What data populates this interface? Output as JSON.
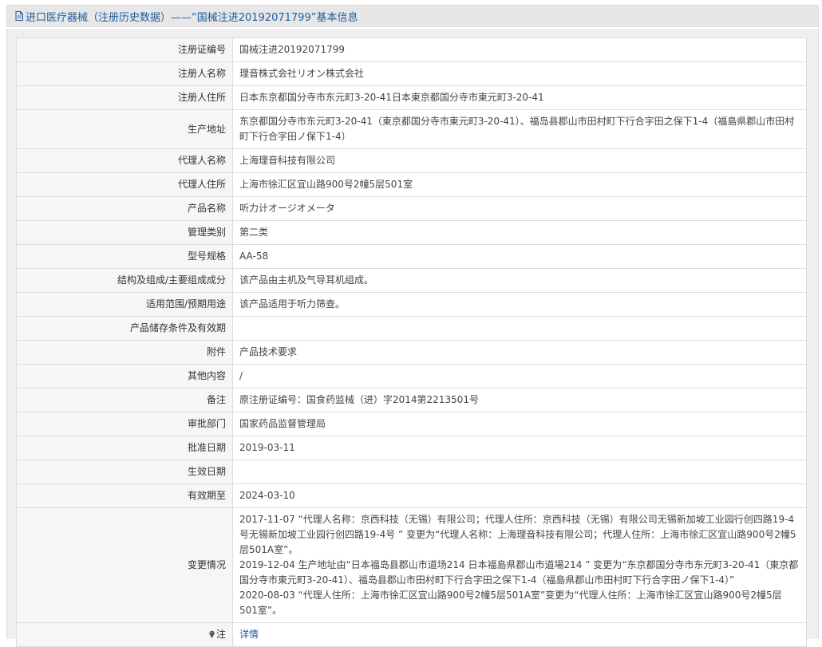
{
  "header": {
    "title": "进口医疗器械（注册历史数据）——“国械注进20192071799”基本信息"
  },
  "rows": [
    {
      "label": "注册证编号",
      "value": "国械注进20192071799"
    },
    {
      "label": "注册人名称",
      "value": "理音株式会社リオン株式会社"
    },
    {
      "label": "注册人住所",
      "value": "日本东京都国分寺市东元町3-20-41日本東京都国分寺市東元町3-20-41"
    },
    {
      "label": "生产地址",
      "value": "东京都国分寺市东元町3-20-41（東京都国分寺市東元町3-20-41）、福岛县郡山市田村町下行合字田之保下1-4（福島県郡山市田村町下行合字田ノ保下1-4）"
    },
    {
      "label": "代理人名称",
      "value": "上海理音科技有限公司"
    },
    {
      "label": "代理人住所",
      "value": "上海市徐汇区宜山路900号2幢5层501室"
    },
    {
      "label": "产品名称",
      "value": "听力计オージオメータ"
    },
    {
      "label": "管理类别",
      "value": "第二类"
    },
    {
      "label": "型号规格",
      "value": "AA-58"
    },
    {
      "label": "结构及组成/主要组成成分",
      "value": "该产品由主机及气导耳机组成。"
    },
    {
      "label": "适用范围/预期用途",
      "value": "该产品适用于听力筛查。"
    },
    {
      "label": "产品储存条件及有效期",
      "value": ""
    },
    {
      "label": "附件",
      "value": "产品技术要求"
    },
    {
      "label": "其他内容",
      "value": "/"
    },
    {
      "label": "备注",
      "value": "原注册证编号：国食药监械（进）字2014第2213501号"
    },
    {
      "label": "审批部门",
      "value": "国家药品监督管理局"
    },
    {
      "label": "批准日期",
      "value": "2019-03-11"
    },
    {
      "label": "生效日期",
      "value": ""
    },
    {
      "label": "有效期至",
      "value": "2024-03-10"
    }
  ],
  "changes": {
    "label": "变更情况",
    "lines": [
      "2017-11-07 “代理人名称：京西科技（无锡）有限公司；代理人住所：京西科技（无锡）有限公司无锡新加坡工业园行创四路19-4号无锡新加坡工业园行创四路19-4号 ” 变更为“代理人名称：上海理音科技有限公司；代理人住所：上海市徐汇区宜山路900号2幢5层501A室”。",
      "2019-12-04 生产地址由“日本福岛县郡山市道场214 日本福島県郡山市道場214 ” 变更为“东京都国分寺市东元町3-20-41（東京都国分寺市東元町3-20-41）、福岛县郡山市田村町下行合字田之保下1-4（福島県郡山市田村町下行合字田ノ保下1-4）”",
      "2020-08-03 “代理人住所：上海市徐汇区宜山路900号2幢5层501A室”变更为“代理人住所：上海市徐汇区宜山路900号2幢5层501室”。"
    ]
  },
  "note": {
    "label": "注",
    "link_text": "详情",
    "icon": "lightbulb-icon"
  },
  "colors": {
    "title": "#1d5c9a",
    "link": "#1d5c9a",
    "label_bg": "#f6f6f6",
    "border": "#dcdcdc"
  }
}
